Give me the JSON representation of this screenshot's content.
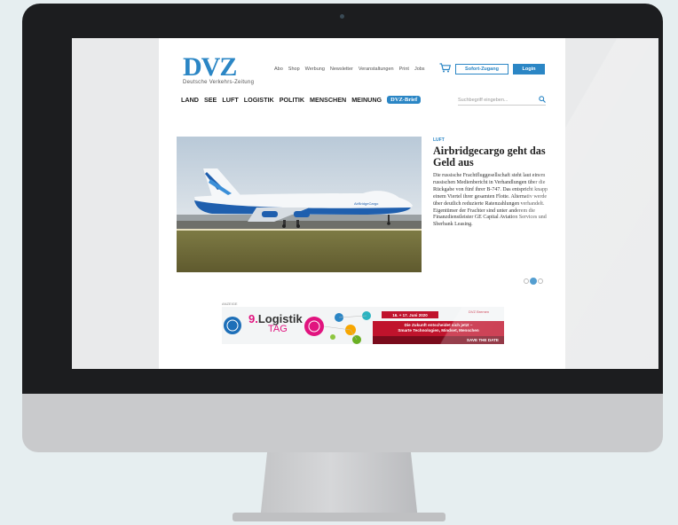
{
  "header": {
    "logo_text": "DVZ",
    "logo_subtitle": "Deutsche Verkehrs-Zeitung",
    "top_links": [
      "Abo",
      "Shop",
      "Werbung",
      "Newsletter",
      "Veranstaltungen",
      "Print",
      "Jobs"
    ],
    "cart_icon": "cart-icon",
    "sofort_label": "Sofort-Zugang",
    "login_label": "Login"
  },
  "nav": {
    "items": [
      "LAND",
      "SEE",
      "LUFT",
      "LOGISTIK",
      "POLITIK",
      "MENSCHEN",
      "MEINUNG"
    ],
    "brief_label": "DVZ-Brief",
    "search_placeholder": "Suchbegriff eingeben...",
    "search_icon": "search-icon"
  },
  "article": {
    "kicker": "LUFT",
    "headline": "Airbridgecargo geht das Geld aus",
    "body": "Die russische Frachtfluggesellschaft steht laut einem russischen Medienbericht in Verhandlungen über die Rückgabe von fünf ihrer B-747. Das entspricht knapp einem Viertel ihrer gesamten Flotte. Alternativ werde über deutlich reduzierte Ratenzahlungen verhandelt. Eigentümer der Frachter sind unter anderem die Finanzdienstleister GE Capital Aviation Services und Sberbank Leasing.",
    "image_livery_text": "AirBridgeCargo",
    "carousel_total": 3,
    "carousel_active": 2
  },
  "ad": {
    "label": "ANZEIGE",
    "logo_part1_num": "9.",
    "logo_part1": "Logistik",
    "logo_part2": "TAG",
    "date": "16. + 17. Juni 2020",
    "brand": "DVZ Bremen",
    "tagline_1": "Die Zukunft entscheidet sich jetzt –",
    "tagline_2": "Smarte Technologien, Mindset, Menschen",
    "save_the_date": "SAVE THE DATE"
  },
  "colors": {
    "brand_blue": "#2b86c5",
    "ad_red": "#c0132c",
    "ad_magenta": "#e1147f"
  }
}
